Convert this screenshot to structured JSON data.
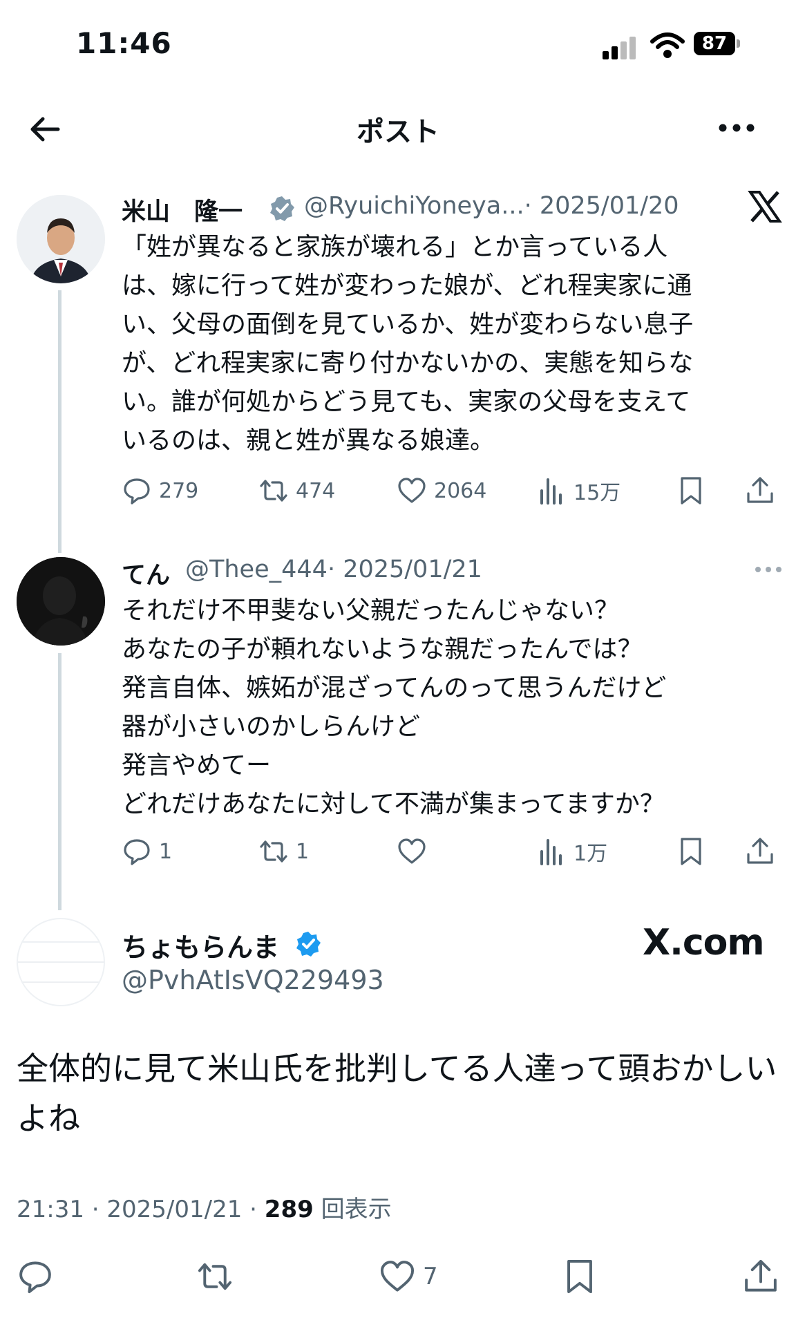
{
  "status_bar": {
    "time": "11:46",
    "battery": "87"
  },
  "nav": {
    "title": "ポスト"
  },
  "tweet1": {
    "name": "米山　隆一",
    "handle": "@RyuichiYoneya...",
    "date": "· 2025/01/20",
    "text": "「姓が異なると家族が壊れる」とか言っている人\nは、嫁に行って姓が変わった娘が、どれ程実家に通\nい、父母の面倒を見ているか、姓が変わらない息子\nが、どれ程実家に寄り付かないかの、実態を知らな\nい。誰が何処からどう見ても、実家の父母を支えて\nいるのは、親と姓が異なる娘達。",
    "replies": "279",
    "retweets": "474",
    "likes": "2064",
    "views": "15万"
  },
  "tweet2": {
    "name": "てん",
    "handle": "@Thee_444",
    "date": "· 2025/01/21",
    "text": "それだけ不甲斐ない父親だったんじゃない？\nあなたの子が頼れないような親だったんでは？\n発言自体、嫉妬が混ざってんのって思うんだけど\n器が小さいのかしらんけど\n発言やめてー\nどれだけあなたに対して不満が集まってますか？",
    "replies": "1",
    "retweets": "1",
    "likes": "",
    "views": "1万"
  },
  "main_post": {
    "name": "ちょもらんま",
    "handle": "@PvhAtIsVQ229493",
    "brand": "X.com",
    "text": "全体的に見て米山氏を批判してる人達って頭おかしい\nよね",
    "time": "21:31 · 2025/01/21 · ",
    "views_count": "289",
    "views_label": " 回表示",
    "likes": "7"
  },
  "colors": {
    "accent": "#1d9bf0",
    "muted": "#536471",
    "line": "#cfd9de"
  },
  "icons": [
    "back-arrow-icon",
    "more-icon",
    "verified-icon",
    "x-logo-icon",
    "reply-icon",
    "retweet-icon",
    "like-icon",
    "views-icon",
    "bookmark-icon",
    "share-icon"
  ]
}
